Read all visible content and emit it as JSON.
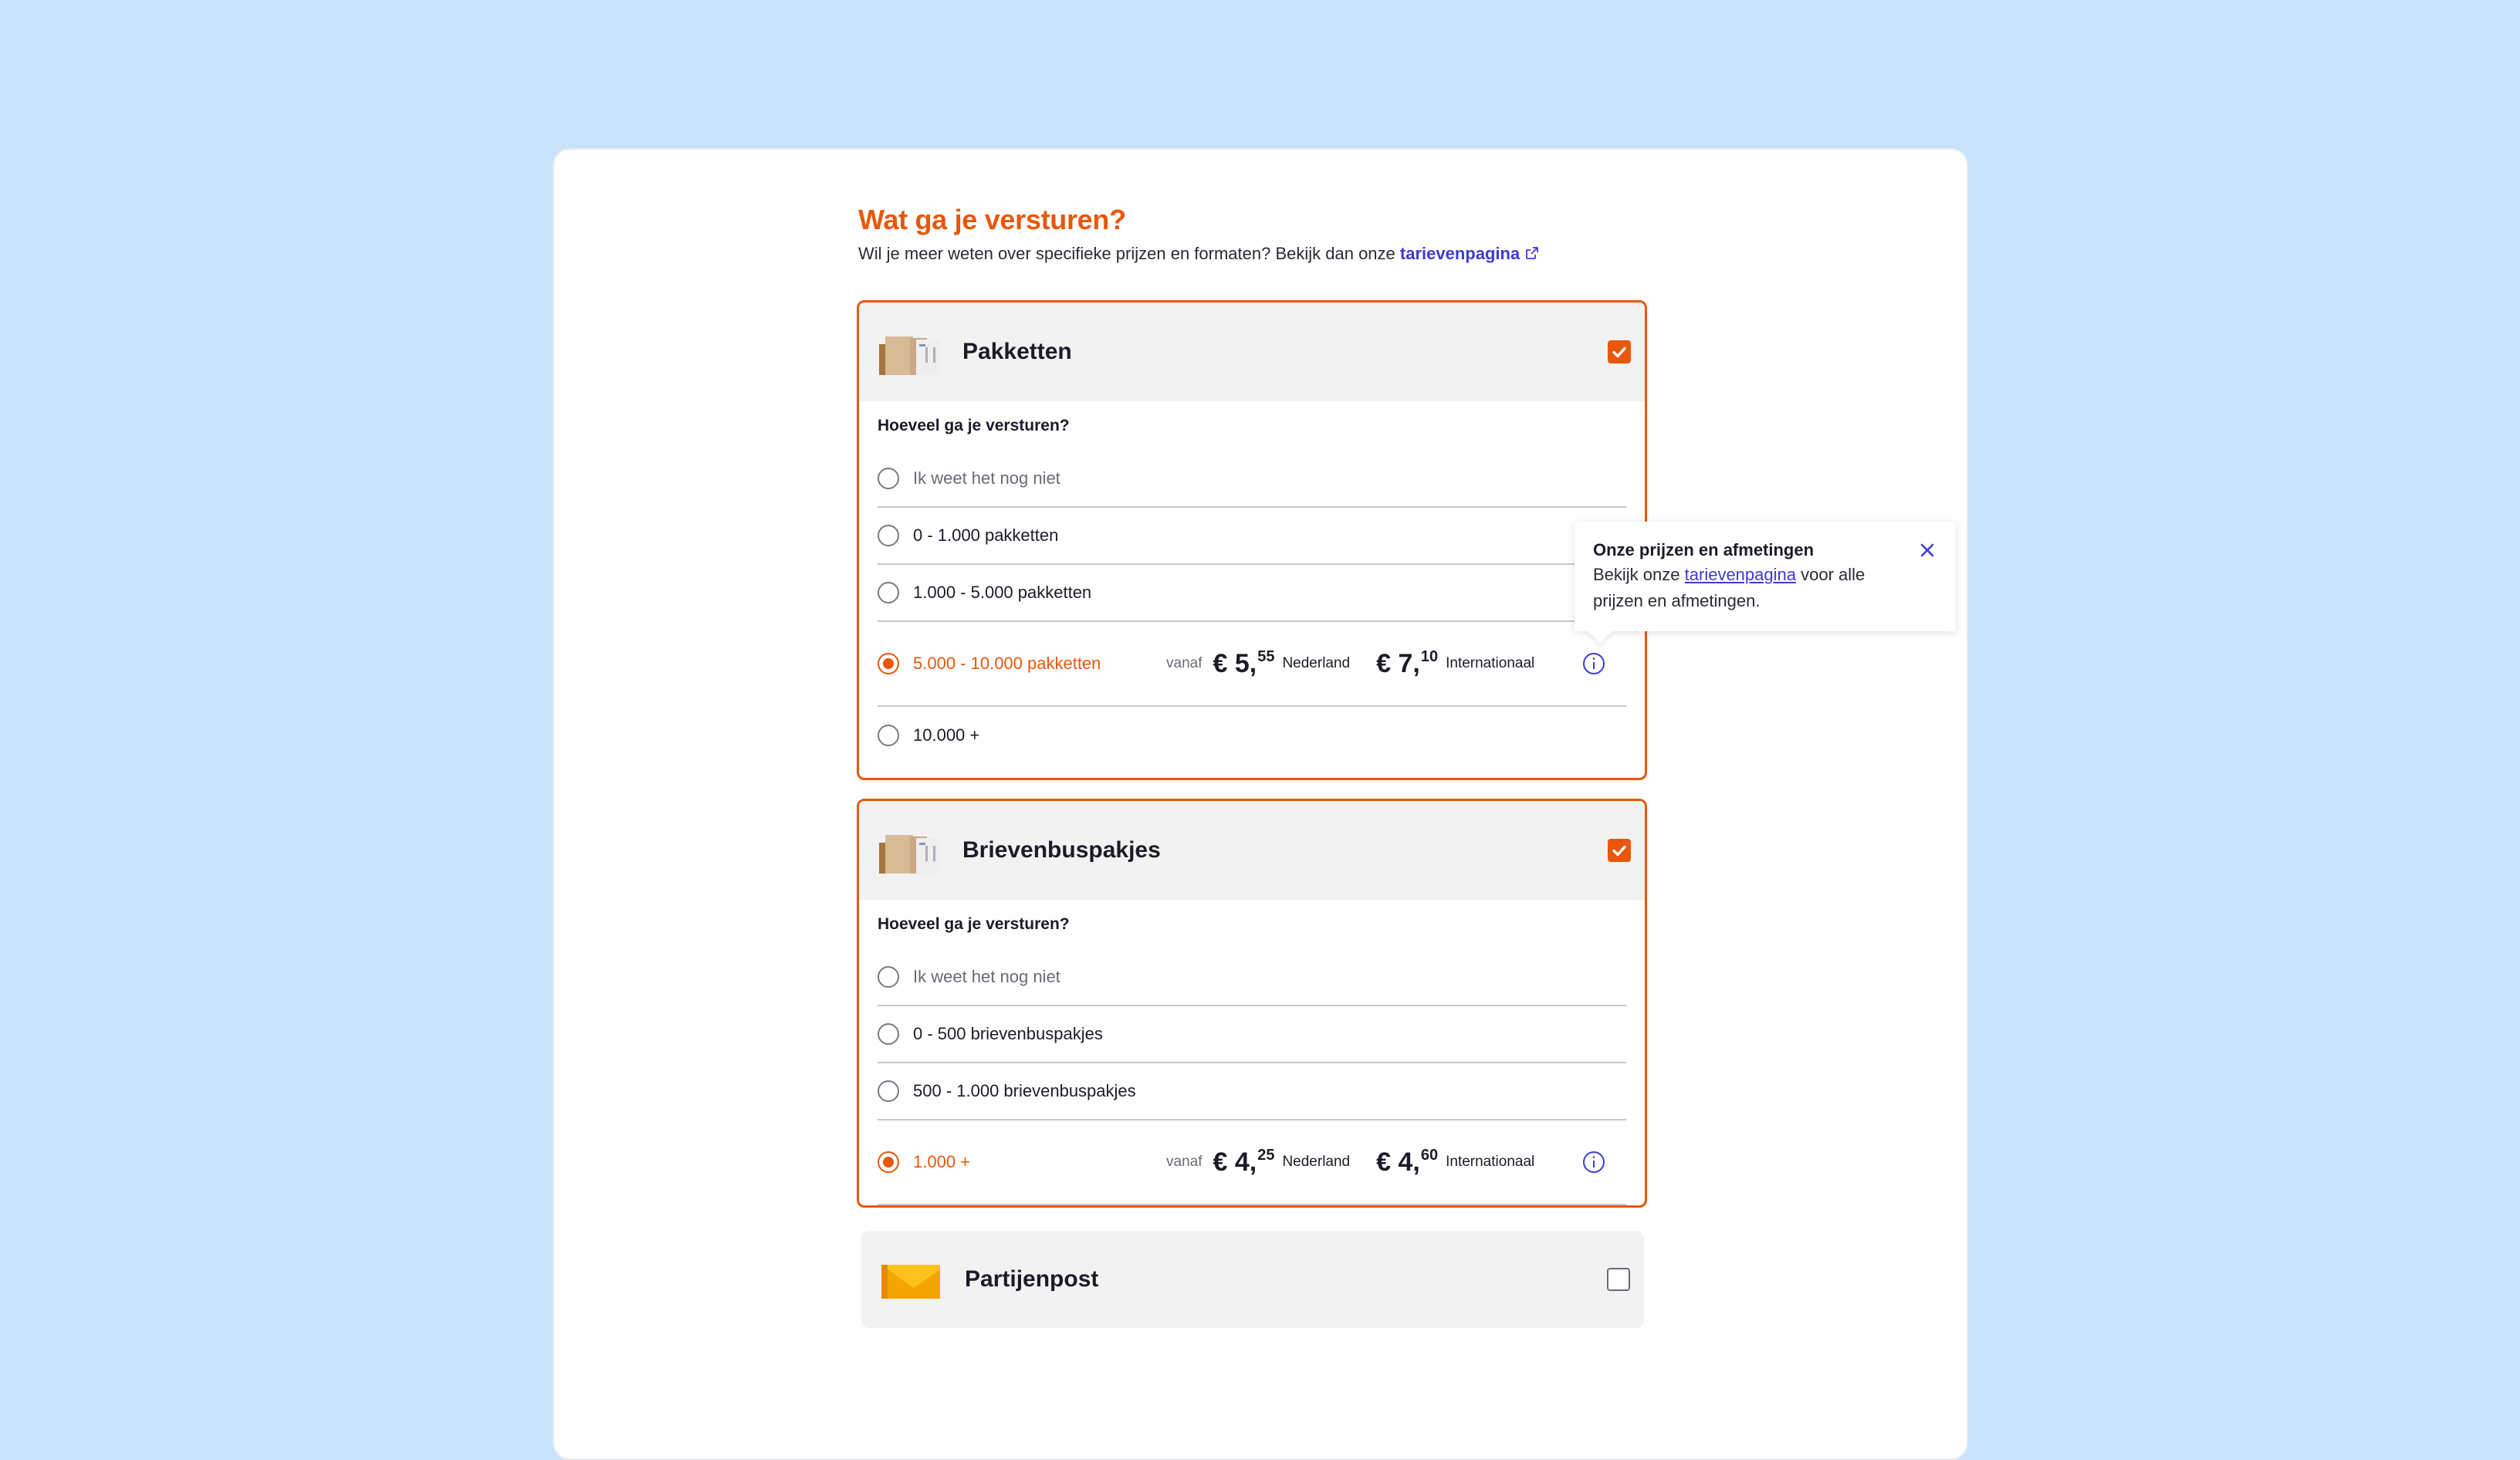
{
  "header": {
    "title": "Wat ga je versturen?",
    "subtitle_prefix": "Wil je meer weten over specifieke prijzen en formaten? Bekijk dan onze",
    "subtitle_link": "tarievenpagina"
  },
  "groups": [
    {
      "title": "Pakketten",
      "checked": true,
      "question": "Hoeveel ga je versturen?",
      "options": [
        {
          "label": "Ik weet het nog niet",
          "selected": false
        },
        {
          "label": "0 - 1.000 pakketten",
          "selected": false
        },
        {
          "label": "1.000 - 5.000 pakketten",
          "selected": false
        },
        {
          "label": "5.000 - 10.000 pakketten",
          "selected": true,
          "from_label": "vanaf",
          "price_nl": "€ 5,",
          "price_nl_cents": "55",
          "region_nl": "Nederland",
          "price_int": "€ 7,",
          "price_int_cents": "10",
          "region_int": "Internationaal"
        },
        {
          "label": "10.000 +",
          "selected": false
        }
      ]
    },
    {
      "title": "Brievenbuspakjes",
      "checked": true,
      "question": "Hoeveel ga je versturen?",
      "options": [
        {
          "label": "Ik weet het nog niet",
          "selected": false
        },
        {
          "label": "0 - 500 brievenbuspakjes",
          "selected": false
        },
        {
          "label": "500 - 1.000 brievenbuspakjes",
          "selected": false
        },
        {
          "label": "1.000 +",
          "selected": true,
          "from_label": "vanaf",
          "price_nl": "€ 4,",
          "price_nl_cents": "25",
          "region_nl": "Nederland",
          "price_int": "€ 4,",
          "price_int_cents": "60",
          "region_int": "Internationaal"
        }
      ]
    },
    {
      "title": "Partijenpost",
      "checked": false
    }
  ],
  "tooltip": {
    "title": "Onze prijzen en afmetingen",
    "text_prefix": "Bekijk onze",
    "link": "tarievenpagina",
    "text_suffix": "voor alle prijzen en afmetingen."
  },
  "colors": {
    "accent": "#e8570c",
    "link": "#3d3bd4",
    "background": "#c9e2fb"
  },
  "icons": {
    "external": "external-link-icon",
    "package": "package-box-icon",
    "envelope": "envelope-icon",
    "info": "info-icon",
    "close": "close-icon"
  }
}
